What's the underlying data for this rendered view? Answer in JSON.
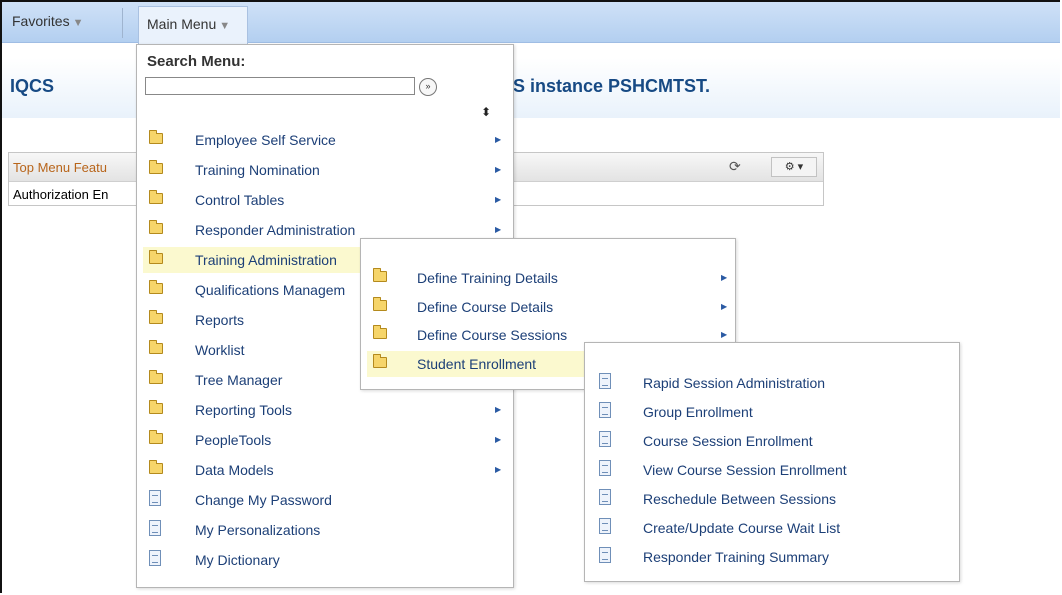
{
  "navbar": {
    "favorites_label": "Favorites",
    "mainmenu_label": "Main Menu"
  },
  "header": {
    "title_left": "IQCS",
    "title_right": "S instance PSHCMTST."
  },
  "pagelet": {
    "title": "Top Menu Featu",
    "row_text": "Authorization En"
  },
  "search": {
    "label": "Search Menu:",
    "value": ""
  },
  "menu1": {
    "items": [
      {
        "label": "Employee Self Service",
        "type": "folder",
        "submenu": true
      },
      {
        "label": "Training Nomination",
        "type": "folder",
        "submenu": true
      },
      {
        "label": "Control Tables",
        "type": "folder",
        "submenu": true
      },
      {
        "label": "Responder Administration",
        "type": "folder",
        "submenu": true
      },
      {
        "label": "Training Administration",
        "type": "folder",
        "submenu": true
      },
      {
        "label": "Qualifications Managem",
        "type": "folder",
        "submenu": true
      },
      {
        "label": "Reports",
        "type": "folder",
        "submenu": true
      },
      {
        "label": "Worklist",
        "type": "folder",
        "submenu": true
      },
      {
        "label": "Tree Manager",
        "type": "folder",
        "submenu": true
      },
      {
        "label": "Reporting Tools",
        "type": "folder",
        "submenu": true
      },
      {
        "label": "PeopleTools",
        "type": "folder",
        "submenu": true
      },
      {
        "label": "Data Models",
        "type": "folder",
        "submenu": true
      },
      {
        "label": "Change My Password",
        "type": "page",
        "submenu": false
      },
      {
        "label": "My Personalizations",
        "type": "page",
        "submenu": false
      },
      {
        "label": "My Dictionary",
        "type": "page",
        "submenu": false
      }
    ]
  },
  "menu2": {
    "items": [
      {
        "label": "Define Training Details",
        "type": "folder",
        "submenu": true
      },
      {
        "label": "Define Course Details",
        "type": "folder",
        "submenu": true
      },
      {
        "label": "Define Course Sessions",
        "type": "folder",
        "submenu": true
      },
      {
        "label": "Student Enrollment",
        "type": "folder",
        "submenu": true
      }
    ]
  },
  "menu3": {
    "items": [
      {
        "label": "Rapid Session Administration",
        "type": "page"
      },
      {
        "label": "Group Enrollment",
        "type": "page"
      },
      {
        "label": "Course Session Enrollment",
        "type": "page"
      },
      {
        "label": "View Course Session Enrollment",
        "type": "page"
      },
      {
        "label": "Reschedule Between Sessions",
        "type": "page"
      },
      {
        "label": "Create/Update Course Wait List",
        "type": "page"
      },
      {
        "label": "Responder Training Summary",
        "type": "page"
      }
    ]
  },
  "icons": {
    "folder": "folder-icon",
    "page": "page-icon",
    "arrow": "submenu-arrow-icon",
    "go": "search-go-icon",
    "sort": "sort-icon",
    "refresh": "refresh-icon",
    "gear": "gear-icon"
  }
}
